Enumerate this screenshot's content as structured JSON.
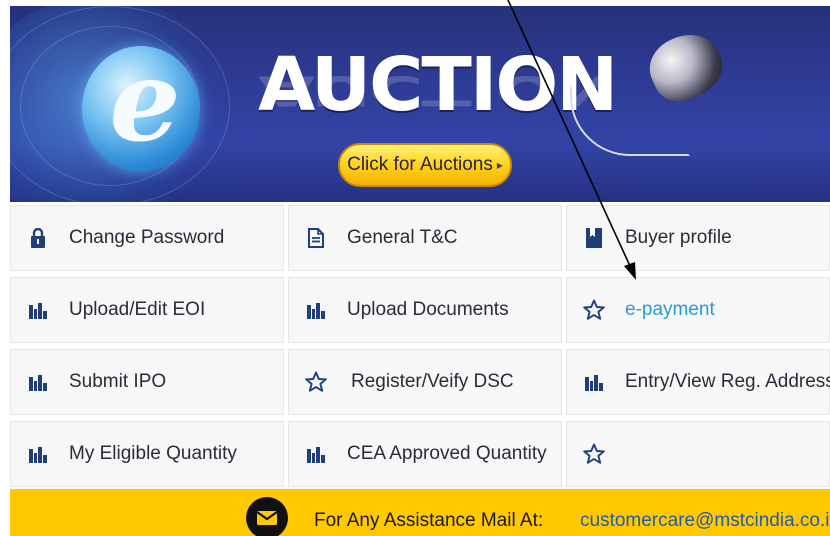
{
  "banner": {
    "logo_letter": "e",
    "title": "AUCTION",
    "cta_label": "Click for Auctions",
    "cta_arrow": "▸"
  },
  "menu": {
    "rows": [
      [
        {
          "label": "Change Password",
          "icon": "lock-icon",
          "link": false
        },
        {
          "label": "General T&C",
          "icon": "document-icon",
          "link": false
        },
        {
          "label": "Buyer profile",
          "icon": "bookmark-icon",
          "link": false
        }
      ],
      [
        {
          "label": "Upload/Edit EOI",
          "icon": "bar-chart-icon",
          "link": false
        },
        {
          "label": "Upload Documents",
          "icon": "bar-chart-icon",
          "link": false
        },
        {
          "label": "e-payment",
          "icon": "star-outline-icon",
          "link": true
        }
      ],
      [
        {
          "label": "Submit IPO",
          "icon": "bar-chart-icon",
          "link": false
        },
        {
          "label": "Register/Veify DSC",
          "icon": "star-outline-icon",
          "link": false
        },
        {
          "label": "Entry/View Reg. Address",
          "icon": "bar-chart-icon",
          "link": false
        }
      ],
      [
        {
          "label": "My Eligible Quantity",
          "icon": "bar-chart-icon",
          "link": false
        },
        {
          "label": "CEA Approved Quantity",
          "icon": "bar-chart-icon",
          "link": false
        },
        {
          "label": "",
          "icon": "star-outline-icon",
          "link": false
        }
      ]
    ]
  },
  "footer": {
    "assist_text": "For Any Assistance Mail At:",
    "email": "customercare@mstcindia.co.in",
    "icon": "mail-icon"
  },
  "colors": {
    "banner_blue": "#2f3c96",
    "footer_yellow": "#ffc800",
    "link_blue": "#2a9bd6",
    "icon_navy": "#1e3f78",
    "email_blue": "#1f5ea8"
  }
}
